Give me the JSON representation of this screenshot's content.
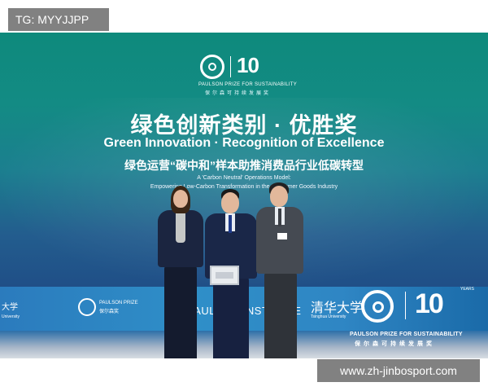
{
  "watermarks": {
    "top_left": "TG: MYYJJPP",
    "bottom_right": "www.zh-jinbosport.com"
  },
  "backdrop": {
    "logo_ten": "10",
    "logo_en": "PAULSON PRIZE FOR SUSTAINABILITY",
    "logo_cn": "保尔森可持续发展奖",
    "title_cn": "绿色创新类别 · 优胜奖",
    "title_en": "Green Innovation · Recognition of Excellence",
    "subtitle_cn": "绿色运营“碳中和”样本助推消费品行业低碳转型",
    "subtitle_en_line1": "A 'Carbon Neutral' Operations Model:",
    "subtitle_en_line2": "Empowering Low-Carbon Transformation in the Consumer Goods Industry"
  },
  "banner": {
    "left_university_cn": "大学",
    "left_university_en": "University",
    "paulson_prize_en": "PAULSON PRIZE",
    "paulson_prize_cn": "保尔森奖",
    "institute": "PAULSON INSTITUTE",
    "tsinghua_cn": "清华大学",
    "tsinghua_en": "Tsinghua University",
    "big_ten": "10",
    "years": "YEARS",
    "caption_en": "PAULSON PRIZE FOR SUSTAINABILITY",
    "caption_cn": "保尔森可持续发展奖"
  },
  "colors": {
    "backdrop_top": "#0e8a7c",
    "backdrop_bottom": "#1b4a7e",
    "banner": "#2f8fc8",
    "watermark_bg": "#737373"
  }
}
